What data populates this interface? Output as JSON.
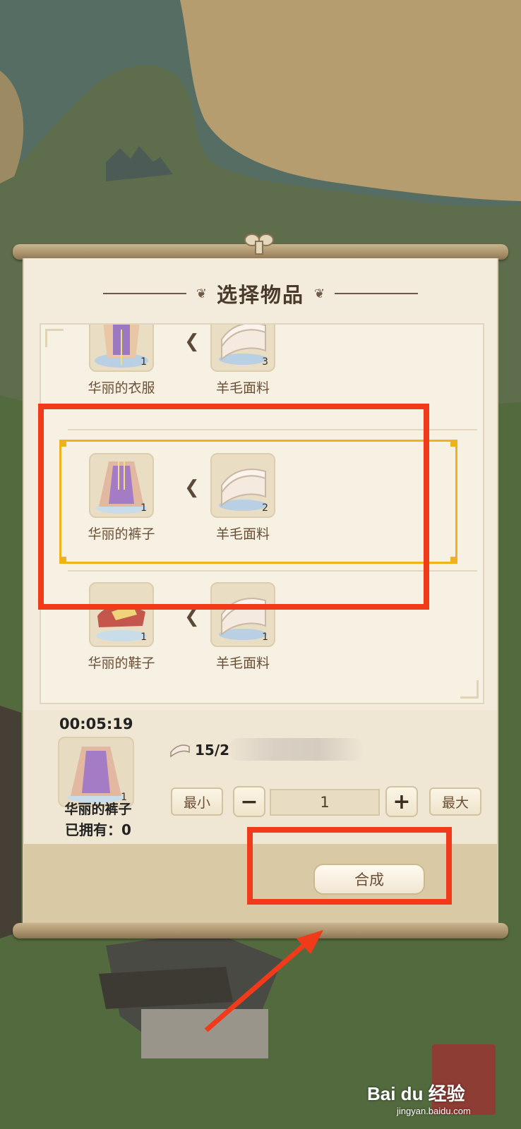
{
  "dialog": {
    "title": "选择物品"
  },
  "recipes": [
    {
      "item_name": "华丽的衣服",
      "item_count": "1",
      "material_name": "羊毛面料",
      "material_count": "3"
    },
    {
      "item_name": "华丽的裤子",
      "item_count": "1",
      "material_name": "羊毛面料",
      "material_count": "2"
    },
    {
      "item_name": "华丽的鞋子",
      "item_count": "1",
      "material_name": "羊毛面料",
      "material_count": "1"
    }
  ],
  "detail": {
    "timer": "00:05:19",
    "item_name": "华丽的裤子",
    "item_count": "1",
    "owned": "已拥有：0",
    "material_requirement": "15/2"
  },
  "quantity": {
    "min_label": "最小",
    "max_label": "最大",
    "minus_symbol": "−",
    "plus_symbol": "+",
    "value": "1"
  },
  "actions": {
    "synthesize_label": "合成"
  },
  "watermark": {
    "brand": "Bai du 经验",
    "url": "jingyan.baidu.com"
  },
  "colors": {
    "highlight": "#f0b21a",
    "annotation": "#f13a1a",
    "panel": "#f3ecdc"
  }
}
